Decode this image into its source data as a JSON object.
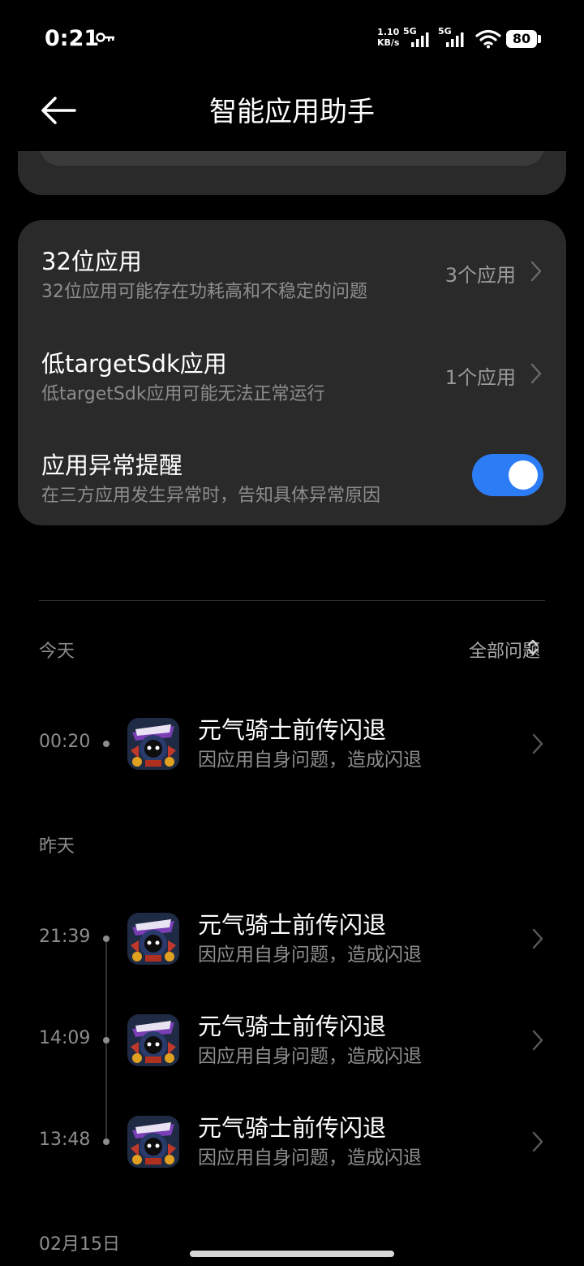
{
  "status_bar": {
    "time": "0:21",
    "speed_value": "1.10",
    "speed_unit": "KB/s",
    "network1": "5G",
    "network2": "5G",
    "battery": "80",
    "icons": [
      "key-icon",
      "signal-icon",
      "signal-icon",
      "wifi-icon",
      "battery-icon"
    ]
  },
  "header": {
    "title": "智能应用助手",
    "back_icon": "arrow-left-icon"
  },
  "settings": [
    {
      "title": "32位应用",
      "subtitle": "32位应用可能存在功耗高和不稳定的问题",
      "value": "3个应用"
    },
    {
      "title": "低targetSdk应用",
      "subtitle": "低targetSdk应用可能无法正常运行",
      "value": "1个应用"
    },
    {
      "title": "应用异常提醒",
      "subtitle": "在三方应用发生异常时，告知具体异常原因",
      "toggle_on": true
    }
  ],
  "log": {
    "filter_label": "全部问题",
    "sections": [
      {
        "label": "今天",
        "entries": [
          {
            "time": "00:20",
            "title": "元气骑士前传闪退",
            "subtitle": "因应用自身问题，造成闪退"
          }
        ]
      },
      {
        "label": "昨天",
        "entries": [
          {
            "time": "21:39",
            "title": "元气骑士前传闪退",
            "subtitle": "因应用自身问题，造成闪退"
          },
          {
            "time": "14:09",
            "title": "元气骑士前传闪退",
            "subtitle": "因应用自身问题，造成闪退"
          },
          {
            "time": "13:48",
            "title": "元气骑士前传闪退",
            "subtitle": "因应用自身问题，造成闪退"
          }
        ]
      },
      {
        "label": "02月15日",
        "entries": []
      }
    ]
  },
  "colors": {
    "background": "#000000",
    "card": "#2a2a2a",
    "toggle_on": "#2c7cf6",
    "secondary_text": "#8d8d8d"
  }
}
